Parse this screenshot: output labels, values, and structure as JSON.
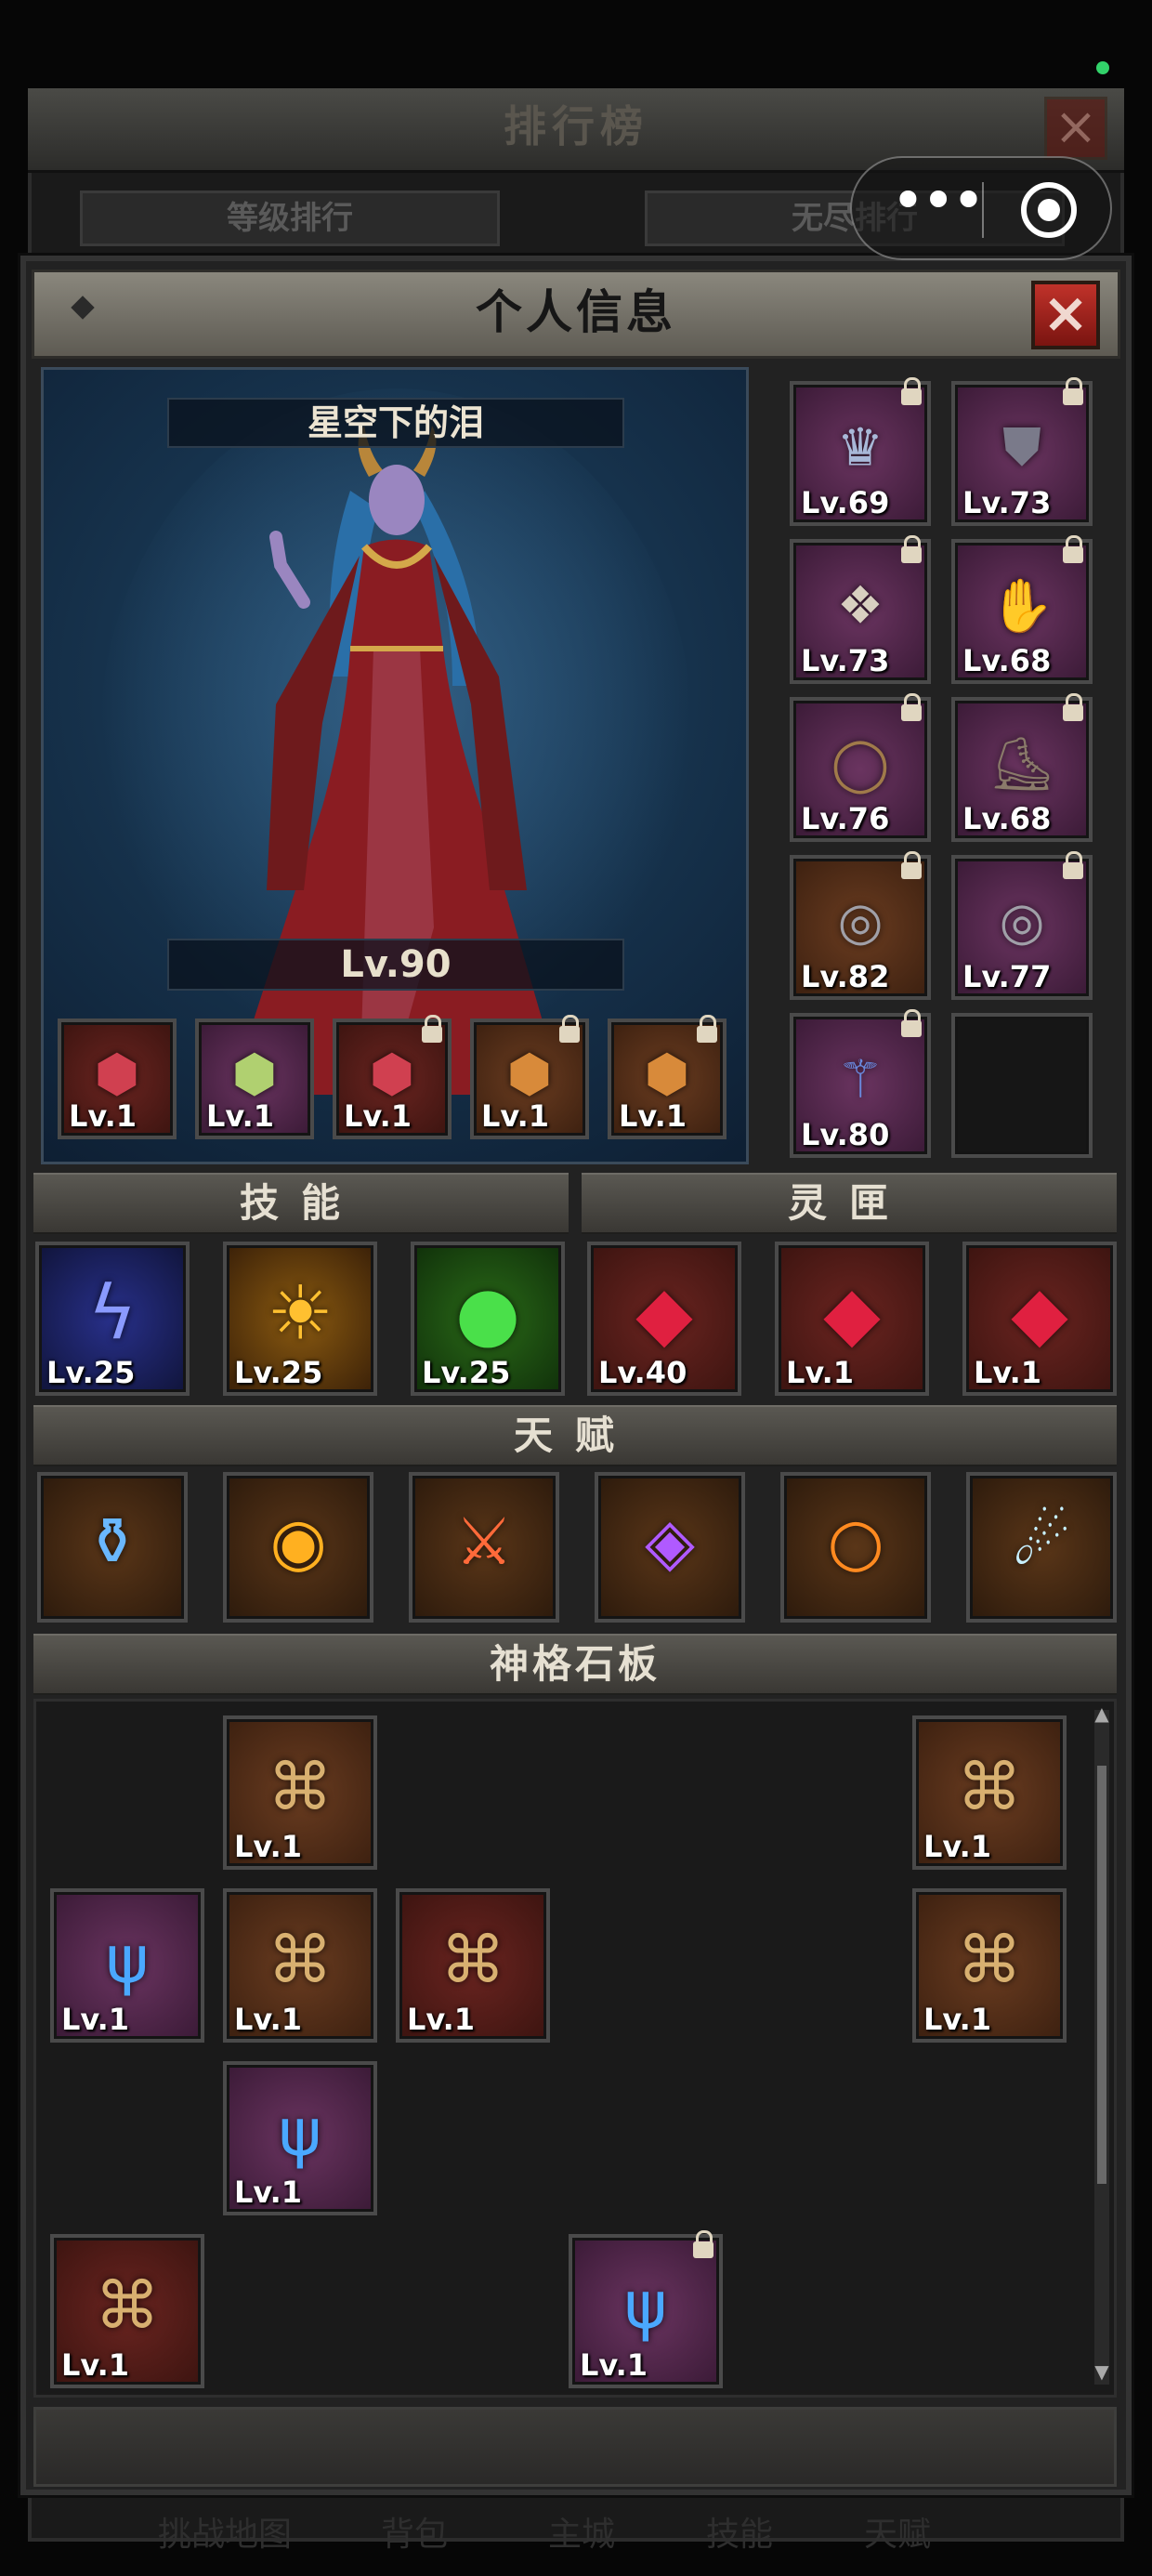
{
  "background": {
    "title": "排行榜",
    "tabs": [
      "等级排行",
      "无尽排行"
    ],
    "bottom_nav": [
      "挑战地图",
      "背包",
      "主城",
      "技能",
      "天赋"
    ]
  },
  "modal": {
    "title": "个人信息",
    "character": {
      "name": "星空下的泪",
      "level": "Lv.90"
    },
    "gem_slots": [
      {
        "icon": "red-gem-icon",
        "level": "Lv.1",
        "locked": false
      },
      {
        "icon": "multicolor-gem-icon",
        "level": "Lv.1",
        "locked": false
      },
      {
        "icon": "red-gem-icon",
        "level": "Lv.1",
        "locked": true
      },
      {
        "icon": "amber-gem-icon",
        "level": "Lv.1",
        "locked": true
      },
      {
        "icon": "amber-gem-icon",
        "level": "Lv.1",
        "locked": true
      }
    ],
    "equipment": [
      {
        "icon": "crown-helmet-icon",
        "level": "Lv.69",
        "locked": true,
        "rarity": "purple"
      },
      {
        "icon": "robe-armor-icon",
        "level": "Lv.73",
        "locked": true,
        "rarity": "purple"
      },
      {
        "icon": "amulet-icon",
        "level": "Lv.73",
        "locked": true,
        "rarity": "purple"
      },
      {
        "icon": "gauntlet-icon",
        "level": "Lv.68",
        "locked": true,
        "rarity": "purple"
      },
      {
        "icon": "belt-icon",
        "level": "Lv.76",
        "locked": true,
        "rarity": "purple"
      },
      {
        "icon": "boots-icon",
        "level": "Lv.68",
        "locked": true,
        "rarity": "purple"
      },
      {
        "icon": "ring-icon",
        "level": "Lv.82",
        "locked": true,
        "rarity": "brown"
      },
      {
        "icon": "ring-icon",
        "level": "Lv.77",
        "locked": true,
        "rarity": "purple"
      },
      {
        "icon": "staff-icon",
        "level": "Lv.80",
        "locked": true,
        "rarity": "purple"
      },
      {
        "icon": "empty-slot",
        "level": "",
        "locked": false,
        "rarity": "dark"
      }
    ],
    "sections": {
      "skills": "技能",
      "spirit_box": "灵匣",
      "talent": "天赋",
      "divinity_board": "神格石板"
    },
    "skills": [
      {
        "icon": "lightning-icon",
        "level": "Lv.25"
      },
      {
        "icon": "holy-light-icon",
        "level": "Lv.25"
      },
      {
        "icon": "green-orb-icon",
        "level": "Lv.25"
      }
    ],
    "spirit_boxes": [
      {
        "icon": "red-cube-icon",
        "level": "Lv.40"
      },
      {
        "icon": "red-cube-icon",
        "level": "Lv.1"
      },
      {
        "icon": "red-cube-icon",
        "level": "Lv.1"
      }
    ],
    "talents": [
      {
        "icon": "rune-bottle-icon"
      },
      {
        "icon": "rune-circle-icon"
      },
      {
        "icon": "rune-sword-icon"
      },
      {
        "icon": "rune-diamond-icon"
      },
      {
        "icon": "rune-ring-icon"
      },
      {
        "icon": "rune-figure-icon"
      }
    ],
    "board_tiles": [
      {
        "icon": "rune-tablet-icon",
        "level": "Lv.1",
        "locked": false,
        "tone": "brown"
      },
      {
        "icon": "rune-tablet-icon",
        "level": "Lv.1",
        "locked": false,
        "tone": "brown"
      },
      {
        "icon": "blue-rune-tablet-icon",
        "level": "Lv.1",
        "locked": false,
        "tone": "purple"
      },
      {
        "icon": "rune-tablet-icon",
        "level": "Lv.1",
        "locked": false,
        "tone": "brown"
      },
      {
        "icon": "rune-tablet-icon",
        "level": "Lv.1",
        "locked": false,
        "tone": "red"
      },
      {
        "icon": "rune-tablet-icon",
        "level": "Lv.1",
        "locked": false,
        "tone": "brown"
      },
      {
        "icon": "blue-rune-tablet-icon",
        "level": "Lv.1",
        "locked": false,
        "tone": "purple"
      },
      {
        "icon": "rune-tablet-icon",
        "level": "Lv.1",
        "locked": false,
        "tone": "red"
      },
      {
        "icon": "blue-rune-tablet-icon",
        "level": "Lv.1",
        "locked": true,
        "tone": "purple"
      }
    ]
  },
  "colors": {
    "close_red": "#b0281f",
    "accent_gold": "#e6e0d2",
    "online_green": "#32d26a"
  }
}
